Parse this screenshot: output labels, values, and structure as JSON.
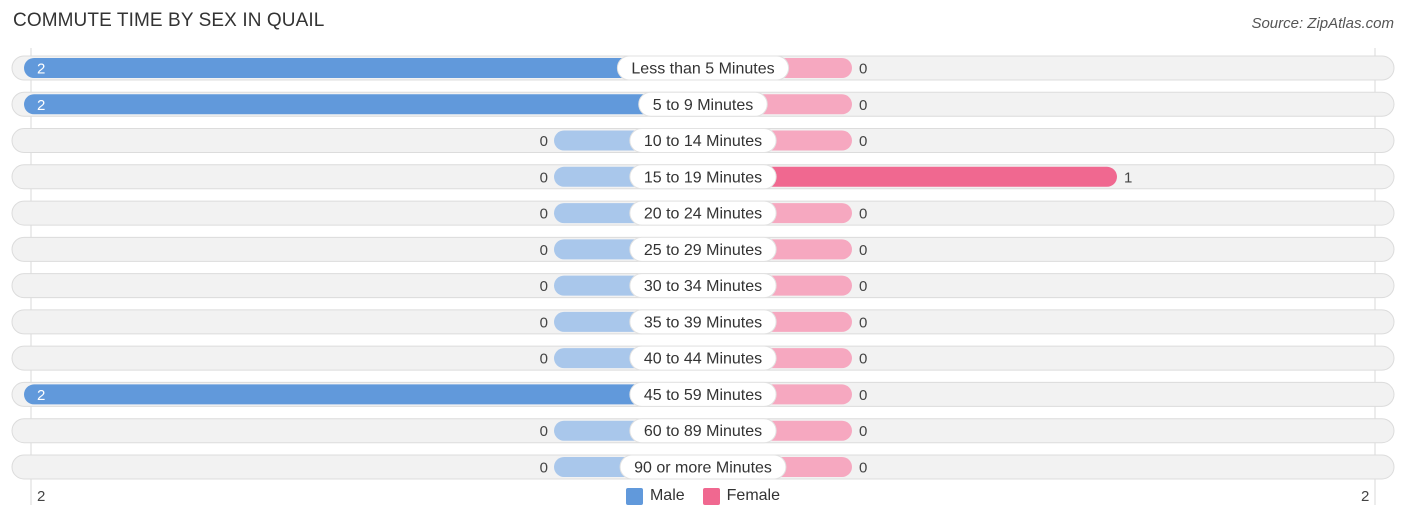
{
  "header": {
    "title": "COMMUTE TIME BY SEX IN QUAIL",
    "source": "Source: ZipAtlas.com"
  },
  "colors": {
    "male": "#6199db",
    "male_light": "#a9c7eb",
    "female": "#f06890",
    "female_light": "#f6a8c0",
    "track": "#f2f2f2",
    "track_border": "#dcdcdc"
  },
  "axis": {
    "left_label": "2",
    "right_label": "2"
  },
  "legend": [
    {
      "label": "Male",
      "key": "male"
    },
    {
      "label": "Female",
      "key": "female"
    }
  ],
  "chart_data": {
    "type": "bar",
    "orientation": "horizontal-diverging",
    "title": "COMMUTE TIME BY SEX IN QUAIL",
    "categories": [
      "Less than 5 Minutes",
      "5 to 9 Minutes",
      "10 to 14 Minutes",
      "15 to 19 Minutes",
      "20 to 24 Minutes",
      "25 to 29 Minutes",
      "30 to 34 Minutes",
      "35 to 39 Minutes",
      "40 to 44 Minutes",
      "45 to 59 Minutes",
      "60 to 89 Minutes",
      "90 or more Minutes"
    ],
    "series": [
      {
        "name": "Male",
        "values": [
          2,
          2,
          0,
          0,
          0,
          0,
          0,
          0,
          0,
          2,
          0,
          0
        ]
      },
      {
        "name": "Female",
        "values": [
          0,
          0,
          0,
          1,
          0,
          0,
          0,
          0,
          0,
          0,
          0,
          0
        ]
      }
    ],
    "xlim": [
      -2,
      2
    ],
    "tick_labels": [
      "2",
      "2"
    ],
    "legend_position": "bottom-center",
    "grid": false
  }
}
